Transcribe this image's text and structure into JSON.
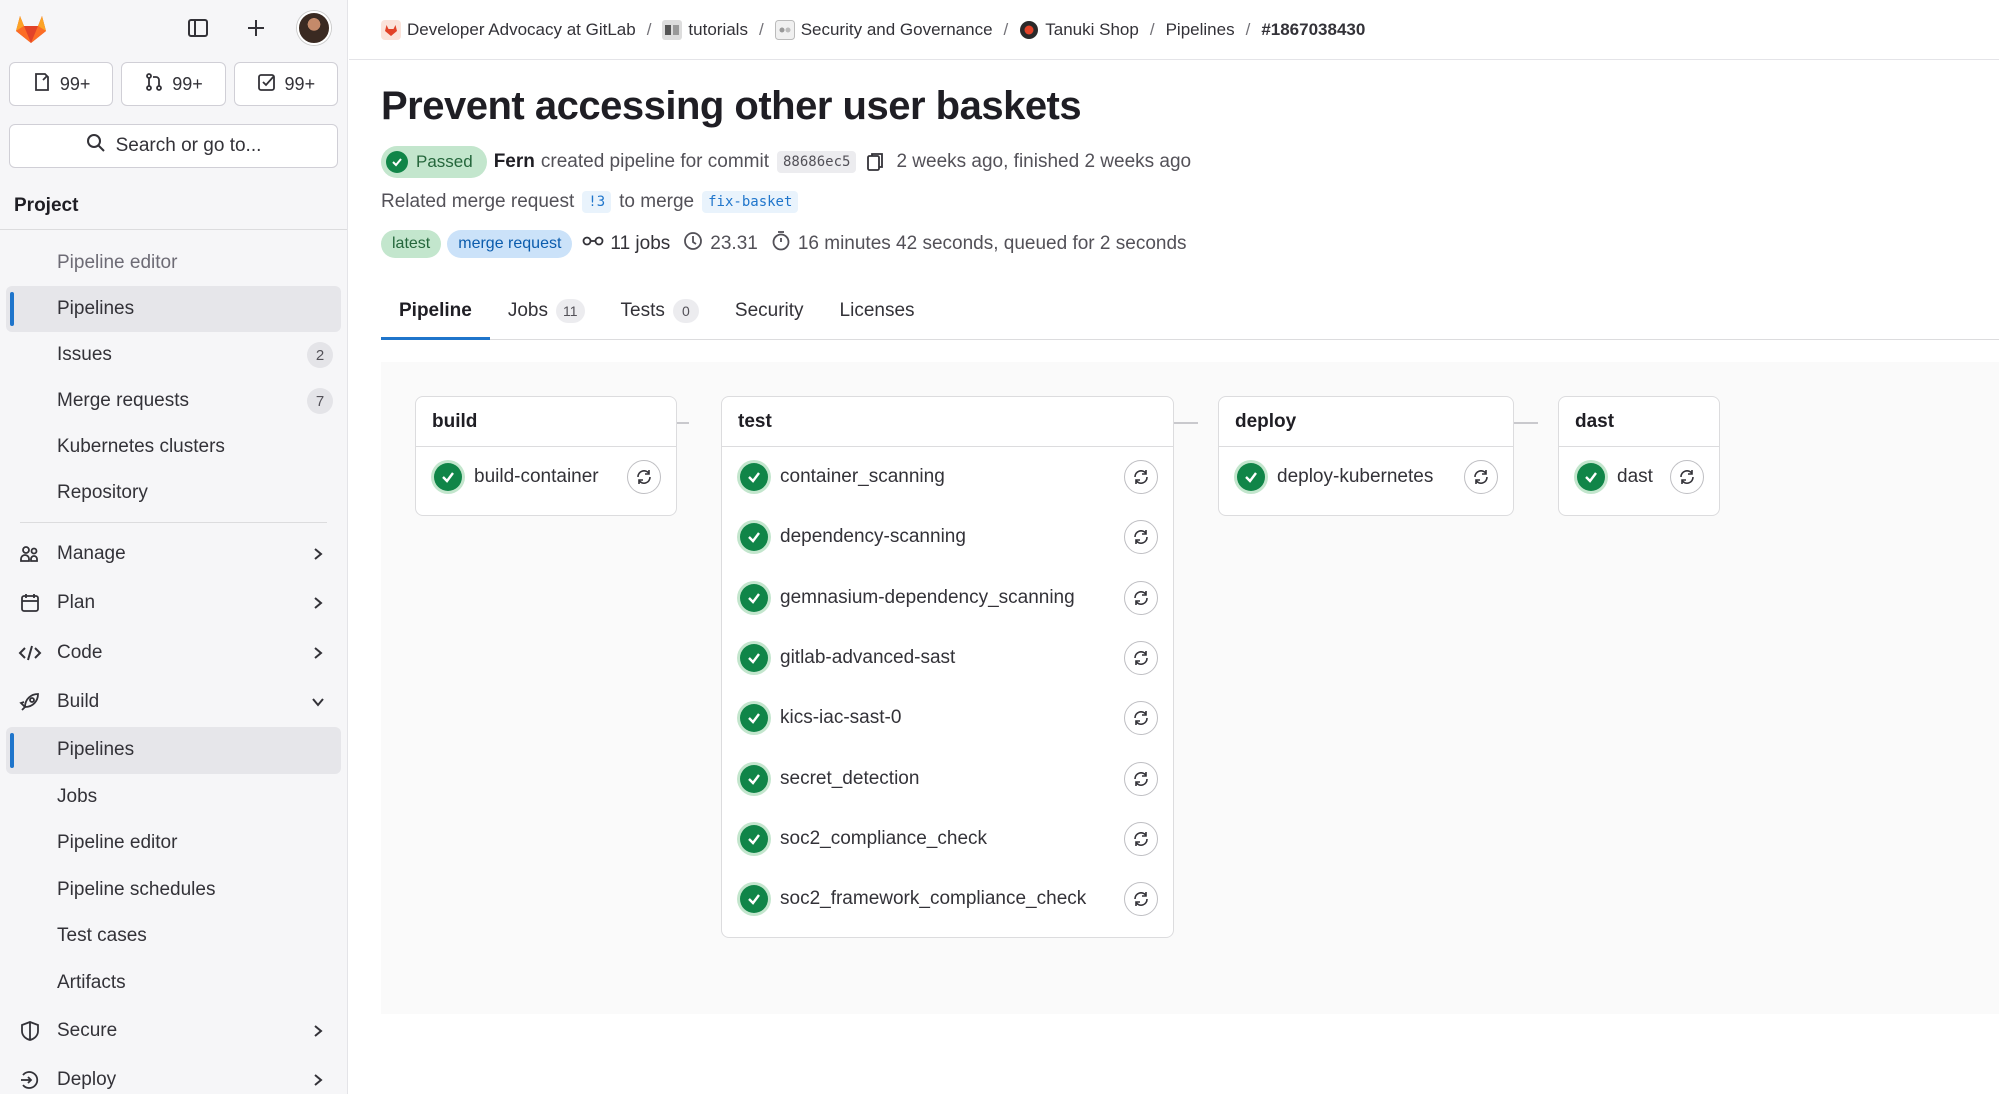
{
  "sidebar": {
    "counts": [
      {
        "icon": "issues-icon",
        "label": "99+"
      },
      {
        "icon": "merge-request-icon",
        "label": "99+"
      },
      {
        "icon": "todo-icon",
        "label": "99+"
      }
    ],
    "search_label": "Search or go to...",
    "section_title": "Project",
    "pinned": [
      {
        "label": "Pipeline editor"
      },
      {
        "label": "Pipelines"
      },
      {
        "label": "Issues",
        "badge": "2"
      },
      {
        "label": "Merge requests",
        "badge": "7"
      },
      {
        "label": "Kubernetes clusters"
      },
      {
        "label": "Repository"
      }
    ],
    "groups": [
      {
        "label": "Manage",
        "icon": "users-icon"
      },
      {
        "label": "Plan",
        "icon": "calendar-icon"
      },
      {
        "label": "Code",
        "icon": "code-icon"
      },
      {
        "label": "Build",
        "icon": "rocket-icon"
      }
    ],
    "build_items": [
      {
        "label": "Pipelines"
      },
      {
        "label": "Jobs"
      },
      {
        "label": "Pipeline editor"
      },
      {
        "label": "Pipeline schedules"
      },
      {
        "label": "Test cases"
      },
      {
        "label": "Artifacts"
      }
    ],
    "groups_after": [
      {
        "label": "Secure",
        "icon": "shield-icon"
      },
      {
        "label": "Deploy",
        "icon": "deploy-icon"
      }
    ]
  },
  "breadcrumb": [
    "Developer Advocacy at GitLab",
    "tutorials",
    "Security and Governance",
    "Tanuki Shop",
    "Pipelines",
    "#1867038430"
  ],
  "pipeline": {
    "title": "Prevent accessing other user baskets",
    "status": "Passed",
    "author": "Fern",
    "created_text": "created pipeline for commit",
    "commit": "88686ec5",
    "time_text": "2 weeks ago, finished 2 weeks ago",
    "related_text": "Related merge request",
    "mr_ref": "!3",
    "to_merge_text": "to merge",
    "branch": "fix-basket",
    "badge_latest": "latest",
    "badge_mr": "merge request",
    "jobs_text": "11 jobs",
    "compute": "23.31",
    "duration_text": "16 minutes 42 seconds, queued for 2 seconds"
  },
  "tabs": [
    {
      "label": "Pipeline"
    },
    {
      "label": "Jobs",
      "count": "11"
    },
    {
      "label": "Tests",
      "count": "0"
    },
    {
      "label": "Security"
    },
    {
      "label": "Licenses"
    }
  ],
  "stages": [
    {
      "name": "build",
      "jobs": [
        "build-container"
      ]
    },
    {
      "name": "test",
      "jobs": [
        "container_scanning",
        "dependency-scanning",
        "gemnasium-dependency_scanning",
        "gitlab-advanced-sast",
        "kics-iac-sast-0",
        "secret_detection",
        "soc2_compliance_check",
        "soc2_framework_compliance_check"
      ]
    },
    {
      "name": "deploy",
      "jobs": [
        "deploy-kubernetes"
      ]
    },
    {
      "name": "dast",
      "jobs": [
        "dast"
      ]
    }
  ],
  "colors": {
    "accent": "#1f75cb",
    "success": "#108548",
    "success_bg": "#c3e6cd"
  }
}
